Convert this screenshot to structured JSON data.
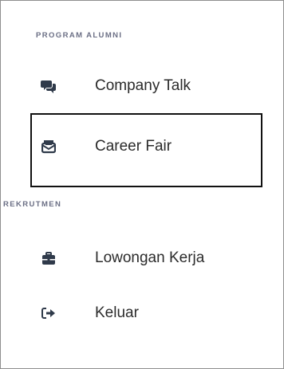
{
  "sidebar": {
    "sections": [
      {
        "title": "PROGRAM ALUMNI",
        "items": [
          {
            "label": "Company Talk",
            "icon": "comments-icon"
          },
          {
            "label": "Career Fair",
            "icon": "envelope-open-icon",
            "selected": true
          }
        ]
      },
      {
        "title": "REKRUTMEN",
        "items": [
          {
            "label": "Lowongan Kerja",
            "icon": "briefcase-icon"
          },
          {
            "label": "Keluar",
            "icon": "sign-out-icon"
          }
        ]
      }
    ]
  },
  "colors": {
    "section_label": "#6b6f85",
    "item_text": "#2b2b2b",
    "icon": "#2f3a4a",
    "selection_border": "#111111"
  }
}
